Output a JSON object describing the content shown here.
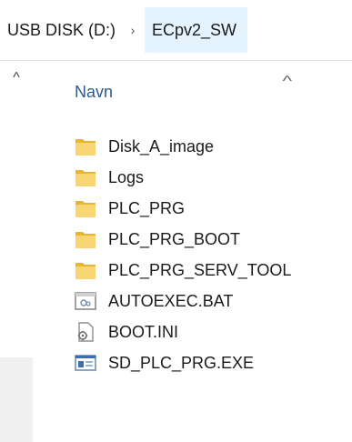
{
  "breadcrumb": {
    "items": [
      "USB DISK (D:)",
      "ECpv2_SW"
    ],
    "separator": "›"
  },
  "navpane": {
    "collapse_glyph": "^"
  },
  "filelist": {
    "column_header": "Navn",
    "sort_glyph": "^",
    "items": [
      {
        "name": "Disk_A_image",
        "icon": "folder-icon"
      },
      {
        "name": "Logs",
        "icon": "folder-icon"
      },
      {
        "name": "PLC_PRG",
        "icon": "folder-icon"
      },
      {
        "name": "PLC_PRG_BOOT",
        "icon": "folder-icon"
      },
      {
        "name": "PLC_PRG_SERV_TOOL",
        "icon": "folder-icon"
      },
      {
        "name": "AUTOEXEC.BAT",
        "icon": "batch-file-icon"
      },
      {
        "name": "BOOT.INI",
        "icon": "settings-file-icon"
      },
      {
        "name": "SD_PLC_PRG.EXE",
        "icon": "executable-icon"
      }
    ]
  },
  "colors": {
    "folder": "#f5c542",
    "selected_crumb": "#e5f3ff",
    "header_text": "#2d5a8a"
  }
}
